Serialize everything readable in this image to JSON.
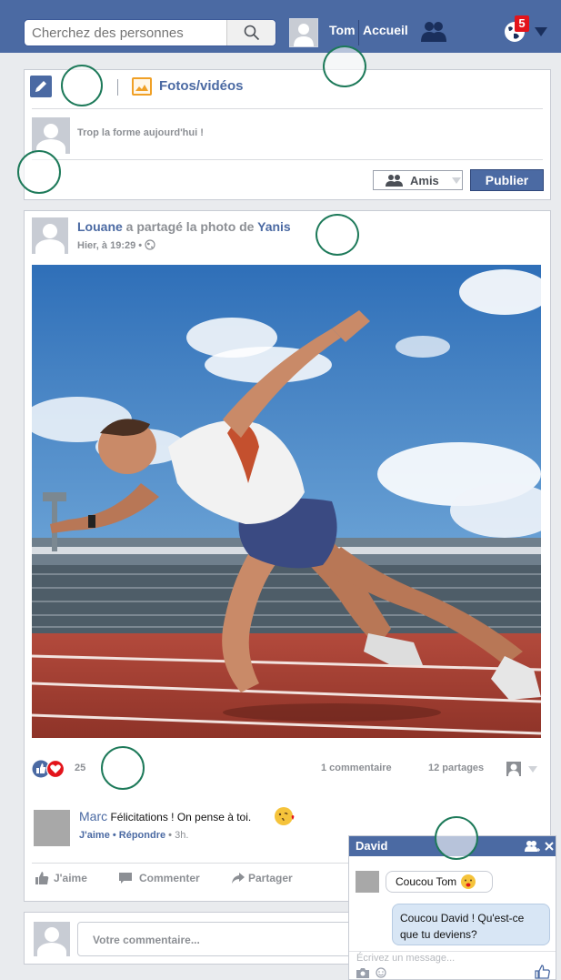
{
  "topbar": {
    "search_placeholder": "Cherchez des personnes",
    "user_name": "Tom",
    "home_label": "Accueil",
    "notification_count": "5"
  },
  "composer": {
    "photo_tab_label": "Fotos/vidéos",
    "status_text": "Trop la forme aujourd'hui !",
    "audience_label": "Amis",
    "publish_label": "Publier"
  },
  "post": {
    "author": "Louane",
    "shared_text": "a partagé la photo de",
    "shared_from": "Yanis",
    "time": "Hier, à 19:29",
    "reaction_count": "25",
    "comment_count_label": "1 commentaire",
    "share_count_label": "12 partages",
    "comment": {
      "author": "Marc",
      "text": "Félicitations ! On pense à toi.",
      "like_reply": "J'aime • Répondre",
      "time": "3h."
    },
    "actions": {
      "like": "J'aime",
      "comment": "Commenter",
      "share": "Partager"
    }
  },
  "comment_input": {
    "placeholder": "Votre commentaire..."
  },
  "chat": {
    "contact": "David",
    "incoming_message": "Coucou Tom",
    "outgoing_message": "Coucou David ! Qu'est-ce que tu deviens?",
    "input_placeholder": "Écrivez un message..."
  },
  "colors": {
    "brand_blue": "#4b6aa3",
    "badge_red": "#e3141b",
    "photo_orange": "#f0a026",
    "annotation_green": "#1e7a5a"
  }
}
